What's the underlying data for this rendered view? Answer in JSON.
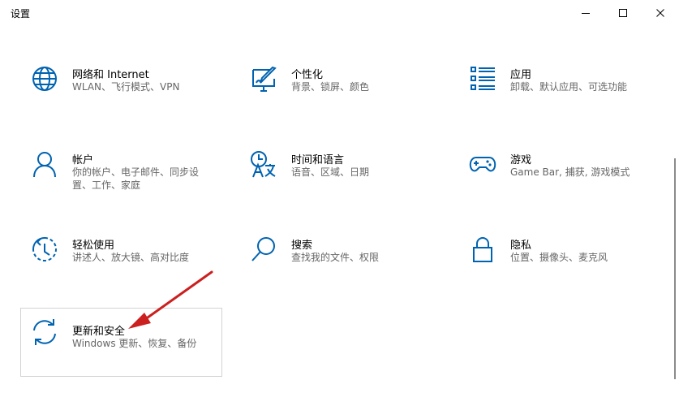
{
  "window": {
    "title": "设置",
    "accent": "#0063b1"
  },
  "tiles": [
    {
      "name": "网络和 Internet",
      "desc": "WLAN、飞行模式、VPN",
      "icon": "globe-icon"
    },
    {
      "name": "个性化",
      "desc": "背景、锁屏、颜色",
      "icon": "personalization-icon"
    },
    {
      "name": "应用",
      "desc": "卸载、默认应用、可选功能",
      "icon": "apps-list-icon"
    },
    {
      "name": "帐户",
      "desc": "你的帐户、电子邮件、同步设置、工作、家庭",
      "icon": "person-icon"
    },
    {
      "name": "时间和语言",
      "desc": "语音、区域、日期",
      "icon": "time-language-icon"
    },
    {
      "name": "游戏",
      "desc": "Game Bar, 捕获, 游戏模式",
      "icon": "gamepad-icon"
    },
    {
      "name": "轻松使用",
      "desc": "讲述人、放大镜、高对比度",
      "icon": "ease-of-access-icon"
    },
    {
      "name": "搜索",
      "desc": "查找我的文件、权限",
      "icon": "search-icon"
    },
    {
      "name": "隐私",
      "desc": "位置、摄像头、麦克风",
      "icon": "lock-icon"
    },
    {
      "name": "更新和安全",
      "desc": "Windows 更新、恢复、备份",
      "icon": "sync-icon"
    }
  ]
}
